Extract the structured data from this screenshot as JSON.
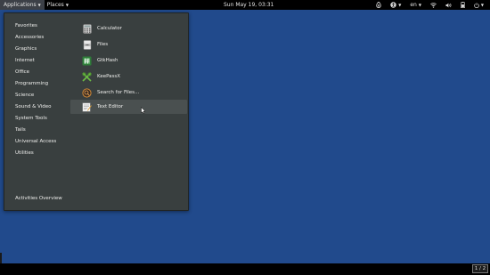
{
  "topbar": {
    "applications_label": "Applications",
    "places_label": "Places",
    "clock": "Sun May 19, 03:31",
    "language": "en",
    "icons": [
      "onion-icon",
      "accessibility-icon",
      "wifi-icon",
      "volume-icon",
      "battery-icon",
      "power-icon"
    ]
  },
  "menu": {
    "categories": [
      "Favorites",
      "Accessories",
      "Graphics",
      "Internet",
      "Office",
      "Programming",
      "Science",
      "Sound & Video",
      "System Tools",
      "Tails",
      "Universal Access",
      "Utilities"
    ],
    "apps": [
      {
        "label": "Calculator",
        "icon": "calculator-icon"
      },
      {
        "label": "Files",
        "icon": "files-icon"
      },
      {
        "label": "GtkHash",
        "icon": "gtkhash-icon"
      },
      {
        "label": "KeePassX",
        "icon": "keepassx-icon"
      },
      {
        "label": "Search for Files...",
        "icon": "search-files-icon"
      },
      {
        "label": "Text Editor",
        "icon": "text-editor-icon"
      }
    ],
    "activities_label": "Activities Overview"
  },
  "bottombar": {
    "workspace": "1 / 2"
  }
}
